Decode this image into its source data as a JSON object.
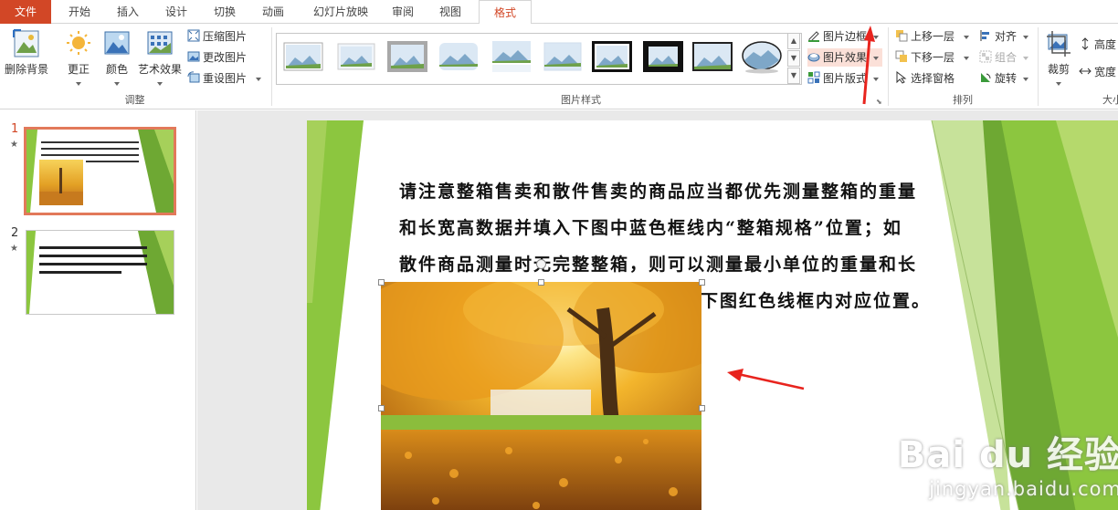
{
  "tabs": {
    "file": "文件",
    "home": "开始",
    "insert": "插入",
    "design": "设计",
    "transitions": "切换",
    "animations": "动画",
    "slideshow": "幻灯片放映",
    "review": "审阅",
    "view": "视图",
    "format": "格式"
  },
  "ribbon": {
    "adjust": {
      "group_label": "调整",
      "remove_background": "删除背景",
      "corrections": "更正",
      "color": "颜色",
      "artistic_effects": "艺术效果",
      "compress": "压缩图片",
      "change_picture": "更改图片",
      "reset_picture": "重设图片"
    },
    "picture_styles": {
      "group_label": "图片样式",
      "border": "图片边框",
      "effects": "图片效果",
      "layout": "图片版式"
    },
    "arrange": {
      "group_label": "排列",
      "bring_forward": "上移一层",
      "send_backward": "下移一层",
      "selection_pane": "选择窗格",
      "align": "对齐",
      "group": "组合",
      "rotate": "旋转"
    },
    "size": {
      "group_label": "大小",
      "crop": "裁剪",
      "height": "高度",
      "width": "宽度"
    }
  },
  "slides": [
    {
      "number": "1",
      "star": "★"
    },
    {
      "number": "2",
      "star": "★"
    }
  ],
  "slide_content": {
    "body_lines": [
      "请注意整箱售卖和散件售卖的商品应当都优先测量整箱的重量",
      "和长宽高数据并填入下图中蓝色框线内“整箱规格”位置；如",
      "散件商品测量时无完整整箱，则可以测量最小单位的重量和长",
      "下图红色线框内对应位置。"
    ]
  },
  "watermark": {
    "logo": "Bai du 经验",
    "url": "jingyan.baidu.com"
  },
  "colors": {
    "file_tab": "#d24726",
    "accent_green": "#7db842",
    "annotation_red": "#e8241e"
  }
}
